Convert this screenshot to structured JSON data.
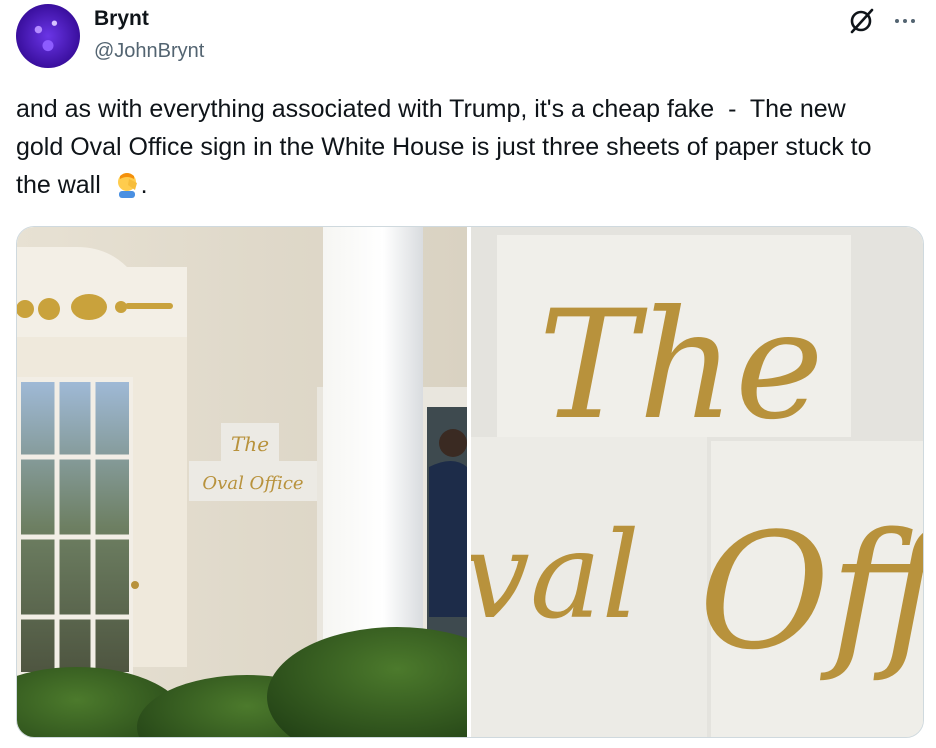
{
  "author": {
    "name": "Brynt",
    "handle": "@JohnBrynt"
  },
  "header_icons": {
    "grok": "grok-icon",
    "more": "more-icon"
  },
  "tweet": {
    "text_before_emoji": "and as with everything associated with Trump, it's a cheap fake  -  The new gold Oval Office sign in the White House is just three sheets of paper stuck to the wall  ",
    "emoji": "facepalm-emoji",
    "text_after_emoji": "."
  },
  "media": {
    "left_image": {
      "sign_line1": "The",
      "sign_line2": "Oval Office"
    },
    "right_image": {
      "closeup_word1": "The",
      "closeup_word2": "val",
      "closeup_word3": "Off"
    }
  },
  "colors": {
    "text": "#0f1419",
    "secondary": "#536471",
    "border": "#cfd9de",
    "gold": "#b8923c"
  }
}
